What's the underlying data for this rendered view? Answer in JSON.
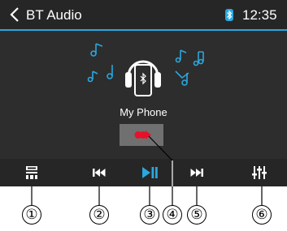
{
  "header": {
    "title": "BT Audio",
    "time": "12:35"
  },
  "device": {
    "name": "My Phone"
  },
  "colors": {
    "accent": "#2aa7de",
    "status_indicator": "#e8102a"
  },
  "icons": {
    "back": "chevron-left-icon",
    "bluetooth": "bluetooth-icon",
    "headphones": "headphones-icon",
    "phone": "phone-icon",
    "music_notes": "music-note-icon",
    "controls": [
      "menu-icon",
      "previous-track-icon",
      "play-pause-icon",
      "next-track-icon",
      "equalizer-icon"
    ]
  },
  "callouts": [
    "①",
    "②",
    "③",
    "④",
    "⑤",
    "⑥"
  ]
}
